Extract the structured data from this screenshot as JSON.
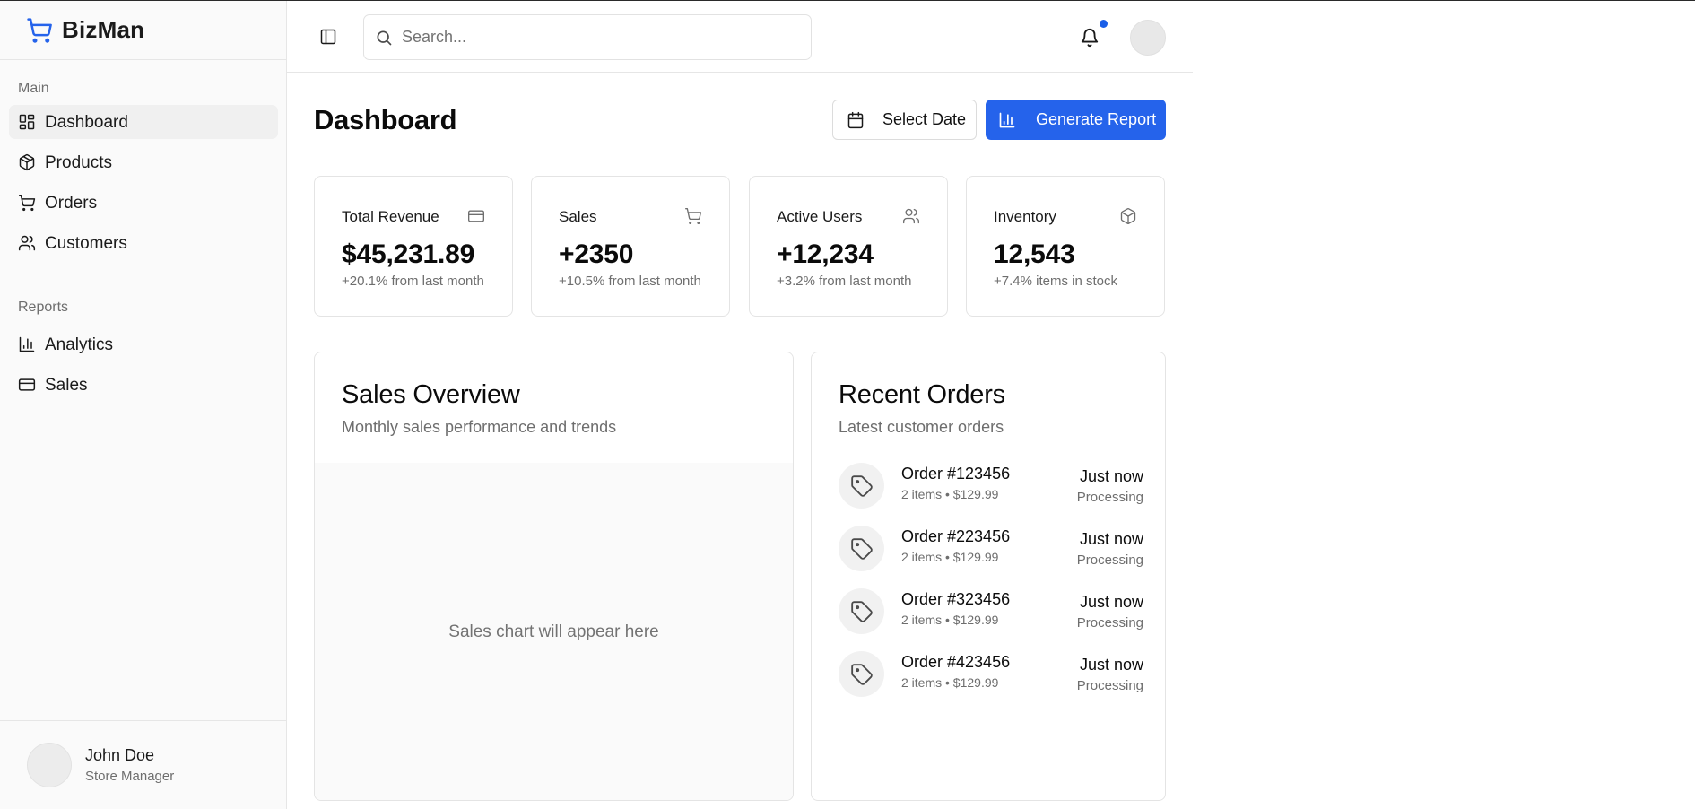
{
  "app": {
    "brand": "BizMan"
  },
  "sidebar": {
    "sections": [
      {
        "label": "Main",
        "items": [
          {
            "label": "Dashboard",
            "icon": "layout-dashboard-icon",
            "active": true
          },
          {
            "label": "Products",
            "icon": "package-icon",
            "active": false
          },
          {
            "label": "Orders",
            "icon": "shopping-cart-icon",
            "active": false
          },
          {
            "label": "Customers",
            "icon": "users-icon",
            "active": false
          }
        ]
      },
      {
        "label": "Reports",
        "items": [
          {
            "label": "Analytics",
            "icon": "bar-chart-icon",
            "active": false
          },
          {
            "label": "Sales",
            "icon": "credit-card-icon",
            "active": false
          }
        ]
      }
    ],
    "user": {
      "name": "John Doe",
      "role": "Store Manager"
    }
  },
  "header": {
    "search_placeholder": "Search...",
    "has_notifications": true
  },
  "main": {
    "title": "Dashboard",
    "select_date_label": "Select Date",
    "generate_report_label": "Generate Report",
    "stats": [
      {
        "title": "Total Revenue",
        "value": "$45,231.89",
        "sub": "+20.1% from last month",
        "icon": "credit-card-icon"
      },
      {
        "title": "Sales",
        "value": "+2350",
        "sub": "+10.5% from last month",
        "icon": "shopping-cart-icon"
      },
      {
        "title": "Active Users",
        "value": "+12,234",
        "sub": "+3.2% from last month",
        "icon": "users-icon"
      },
      {
        "title": "Inventory",
        "value": "12,543",
        "sub": "+7.4% items in stock",
        "icon": "package-icon"
      }
    ],
    "sales_overview": {
      "title": "Sales Overview",
      "subtitle": "Monthly sales performance and trends",
      "placeholder": "Sales chart will appear here"
    },
    "recent_orders": {
      "title": "Recent Orders",
      "subtitle": "Latest customer orders",
      "orders": [
        {
          "id": "Order #123456",
          "meta": "2 items • $129.99",
          "time": "Just now",
          "status": "Processing"
        },
        {
          "id": "Order #223456",
          "meta": "2 items • $129.99",
          "time": "Just now",
          "status": "Processing"
        },
        {
          "id": "Order #323456",
          "meta": "2 items • $129.99",
          "time": "Just now",
          "status": "Processing"
        },
        {
          "id": "Order #423456",
          "meta": "2 items • $129.99",
          "time": "Just now",
          "status": "Processing"
        }
      ]
    }
  },
  "colors": {
    "accent": "#2563eb",
    "notification_dot": "#1a5fe8",
    "sidebar_bg": "#fafafa"
  }
}
